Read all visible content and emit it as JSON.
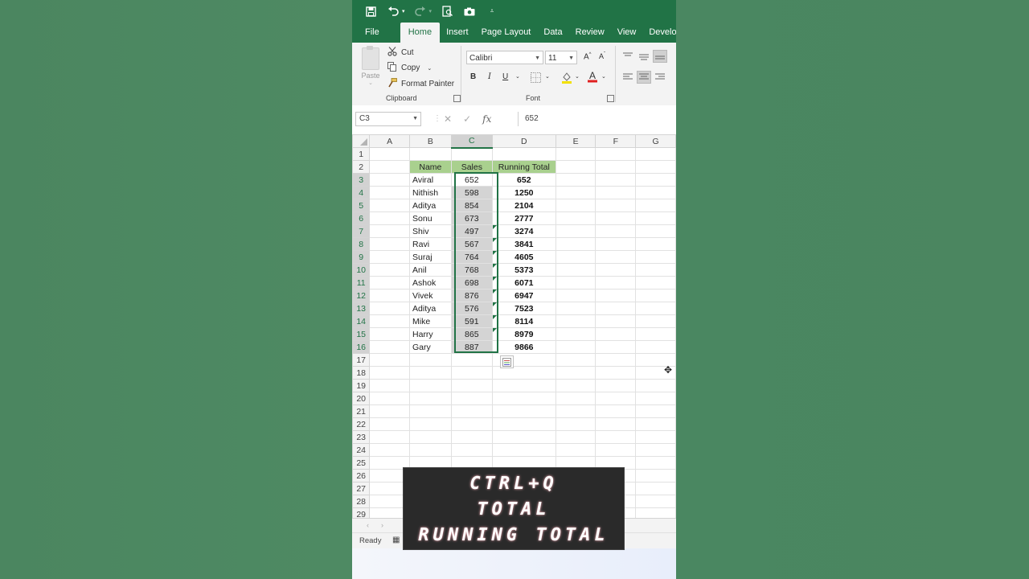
{
  "ribbon_tabs": [
    "File",
    "Home",
    "Insert",
    "Page Layout",
    "Data",
    "Review",
    "View",
    "Developer"
  ],
  "active_tab": "Home",
  "qat_icons": [
    "save-icon",
    "undo-icon",
    "redo-icon",
    "print-preview-icon",
    "camera-icon",
    "customize-qat-icon"
  ],
  "clipboard": {
    "paste": "Paste",
    "cut": "Cut",
    "copy": "Copy",
    "format_painter": "Format Painter",
    "group_label": "Clipboard"
  },
  "font": {
    "name": "Calibri",
    "size": "11",
    "group_label": "Font",
    "bold": "B",
    "italic": "I",
    "underline": "U"
  },
  "formula_bar": {
    "name_box": "C3",
    "value": "652"
  },
  "columns": [
    "A",
    "B",
    "C",
    "D",
    "E",
    "F",
    "G"
  ],
  "rows": [
    "1",
    "2",
    "3",
    "4",
    "5",
    "6",
    "7",
    "8",
    "9",
    "10",
    "11",
    "12",
    "13",
    "14",
    "15",
    "16",
    "17",
    "18",
    "19",
    "20",
    "21",
    "22",
    "23",
    "24",
    "25",
    "26",
    "27",
    "28",
    "29"
  ],
  "table": {
    "headers": [
      "Name",
      "Sales",
      "Running Total"
    ],
    "data": [
      {
        "name": "Aviral",
        "sales": "652",
        "running": "652"
      },
      {
        "name": "Nithish",
        "sales": "598",
        "running": "1250"
      },
      {
        "name": "Aditya",
        "sales": "854",
        "running": "2104"
      },
      {
        "name": "Sonu",
        "sales": "673",
        "running": "2777"
      },
      {
        "name": "Shiv",
        "sales": "497",
        "running": "3274"
      },
      {
        "name": "Ravi",
        "sales": "567",
        "running": "3841"
      },
      {
        "name": "Suraj",
        "sales": "764",
        "running": "4605"
      },
      {
        "name": "Anil",
        "sales": "768",
        "running": "5373"
      },
      {
        "name": "Ashok",
        "sales": "698",
        "running": "6071"
      },
      {
        "name": "Vivek",
        "sales": "876",
        "running": "6947"
      },
      {
        "name": "Aditya",
        "sales": "576",
        "running": "7523"
      },
      {
        "name": "Mike",
        "sales": "591",
        "running": "8114"
      },
      {
        "name": "Harry",
        "sales": "865",
        "running": "8979"
      },
      {
        "name": "Gary",
        "sales": "887",
        "running": "9866"
      }
    ]
  },
  "status": {
    "ready": "Ready"
  },
  "overlay_text": {
    "line1": "CTRL+Q",
    "line2": "TOTAL",
    "line3": "RUNNING TOTAL"
  },
  "colors": {
    "excel_green": "#217346",
    "header_fill": "#a9d08e",
    "background": "#4b8660"
  }
}
